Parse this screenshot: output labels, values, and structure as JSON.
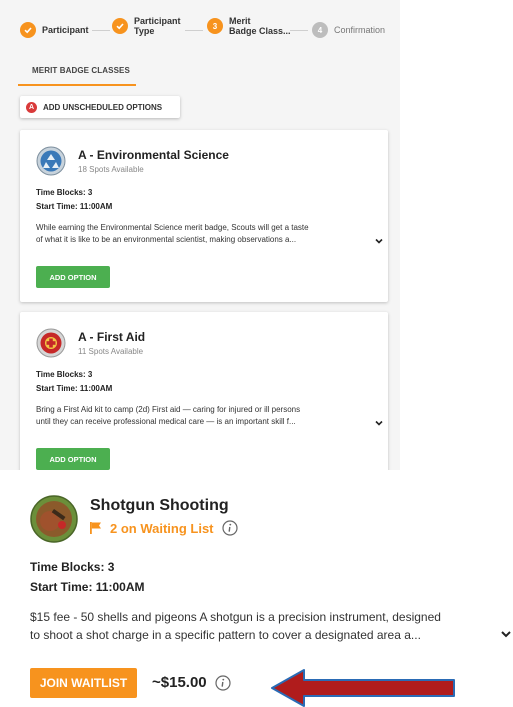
{
  "stepper": {
    "steps": [
      {
        "label": "Participant",
        "status": "done",
        "marker": ""
      },
      {
        "label": "Participant\nType",
        "status": "done",
        "marker": ""
      },
      {
        "label": "Merit\nBadge Class...",
        "status": "active",
        "marker": "3"
      },
      {
        "label": "Confirmation",
        "status": "todo",
        "marker": "4"
      }
    ]
  },
  "tab": {
    "label": "MERIT BADGE CLASSES"
  },
  "unscheduled": {
    "marker": "A",
    "label": "ADD UNSCHEDULED OPTIONS"
  },
  "cards": [
    {
      "title": "A - Environmental Science",
      "spots": "18 Spots Available",
      "time_blocks": "Time Blocks: 3",
      "start_time": "Start Time: 11:00AM",
      "desc_line1": "While earning the Environmental Science merit badge, Scouts will get a taste",
      "desc_line2": "of what it is like to be an environmental scientist, making observations a...",
      "button": "ADD OPTION",
      "icon": "recycle-badge-icon"
    },
    {
      "title": "A - First Aid",
      "spots": "11 Spots Available",
      "time_blocks": "Time Blocks: 3",
      "start_time": "Start Time: 11:00AM",
      "desc_line1": "Bring a First Aid kit to camp (2d) First aid — caring for injured or ill persons",
      "desc_line2": "until they can receive professional medical care — is an important skill f...",
      "button": "ADD OPTION",
      "icon": "first-aid-badge-icon"
    }
  ],
  "shotgun": {
    "title": "Shotgun Shooting",
    "waitlist": "2 on Waiting List",
    "time_blocks": "Time Blocks: 3",
    "start_time": "Start Time: 11:00AM",
    "desc_line1": "$15 fee - 50 shells and pigeons A shotgun is a precision instrument, designed",
    "desc_line2": "to shoot a shot charge in a specific pattern to cover a designated area a...",
    "button": "JOIN WAITLIST",
    "price": "~$15.00",
    "icon": "shotgun-badge-icon"
  },
  "colors": {
    "accent_orange": "#f7931e",
    "add_green": "#4caf50",
    "badge_red": "#d93a3a",
    "arrow_red": "#b01c1c",
    "arrow_outline": "#2a6bb5"
  }
}
